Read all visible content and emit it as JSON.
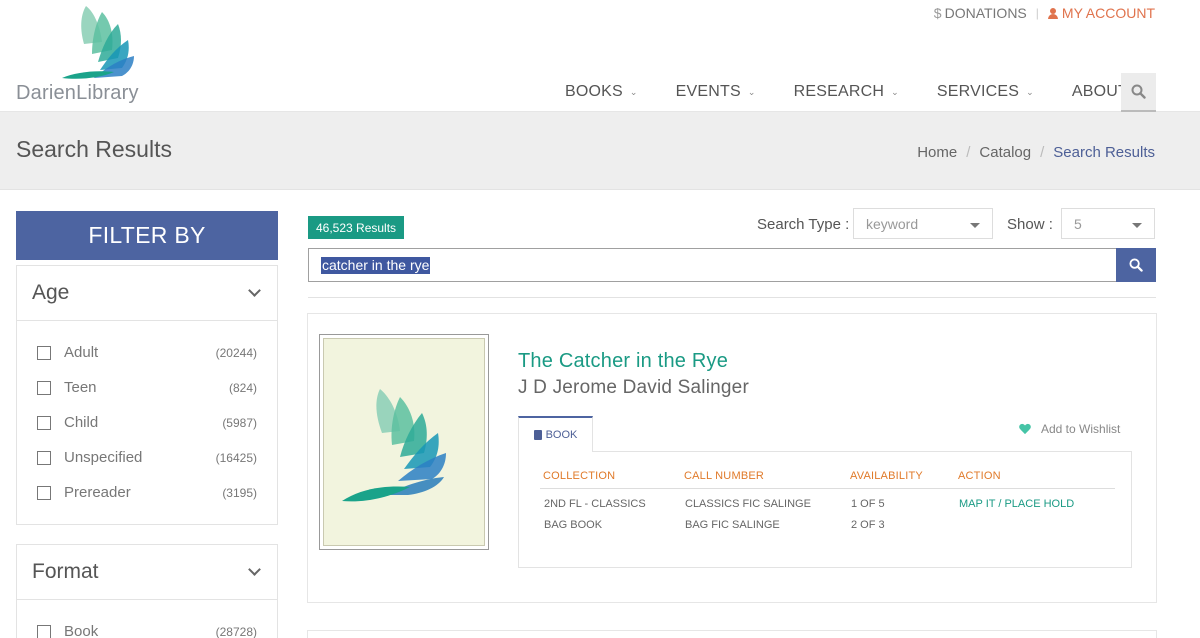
{
  "header": {
    "logo_text": "DarienLibrary",
    "donations": "DONATIONS",
    "my_account": "MY ACCOUNT",
    "nav": [
      "BOOKS",
      "EVENTS",
      "RESEARCH",
      "SERVICES",
      "ABOUT"
    ]
  },
  "page": {
    "title": "Search Results",
    "breadcrumb": [
      "Home",
      "Catalog",
      "Search Results"
    ]
  },
  "sidebar": {
    "filter_title": "FILTER BY",
    "facets": [
      {
        "name": "Age",
        "items": [
          {
            "label": "Adult",
            "count": "(20244)"
          },
          {
            "label": "Teen",
            "count": "(824)"
          },
          {
            "label": "Child",
            "count": "(5987)"
          },
          {
            "label": "Unspecified",
            "count": "(16425)"
          },
          {
            "label": "Prereader",
            "count": "(3195)"
          }
        ]
      },
      {
        "name": "Format",
        "items": [
          {
            "label": "Book",
            "count": "(28728)"
          }
        ]
      }
    ]
  },
  "results": {
    "count_label": "46,523 Results",
    "search_type_label": "Search Type :",
    "search_type_value": "keyword",
    "show_label": "Show :",
    "show_value": "5",
    "query": "catcher in the rye"
  },
  "items": [
    {
      "title": "The Catcher in the Rye",
      "author": "J D Jerome David Salinger",
      "format_tab": "BOOK",
      "wishlist": "Add to Wishlist",
      "headers": [
        "COLLECTION",
        "CALL NUMBER",
        "AVAILABILITY",
        "ACTION"
      ],
      "rows": [
        {
          "collection": "2ND FL - CLASSICS",
          "call_number": "CLASSICS FIC SALINGE",
          "availability": "1 OF 5",
          "action_map": "MAP IT",
          "action_sep": "/",
          "action_hold": "PLACE HOLD"
        },
        {
          "collection": "BAG BOOK",
          "call_number": "BAG FIC SALINGE",
          "availability": "2 OF 3"
        }
      ]
    }
  ],
  "colors": {
    "brand_blue": "#4d64a1",
    "teal": "#1a9a84",
    "orange": "#e07a2a",
    "account_orange": "#e0734d"
  },
  "icons": [
    "logo-leaf-icon",
    "dollar-icon",
    "user-icon",
    "chevron-down-icon",
    "search-icon",
    "book-icon",
    "heart-icon"
  ]
}
